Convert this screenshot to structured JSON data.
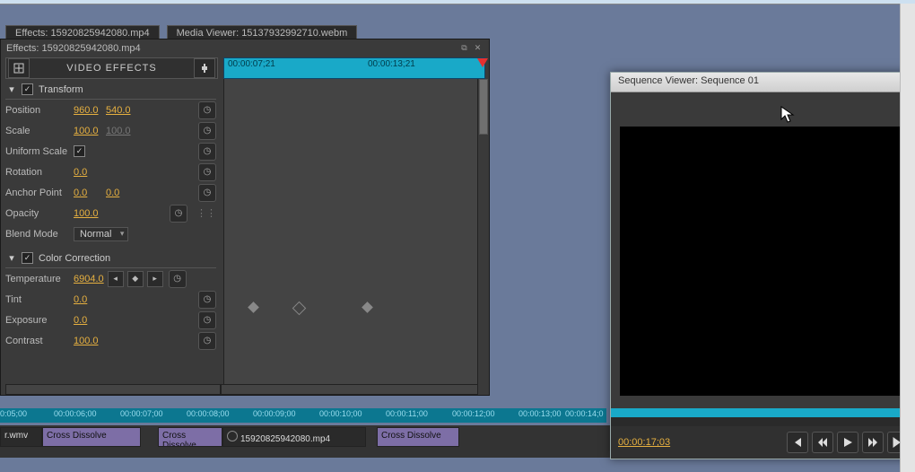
{
  "tabs": {
    "effects": "Effects: 15920825942080.mp4",
    "media": "Media Viewer: 15137932992710.webm"
  },
  "subtitle": "Effects: 15920825942080.mp4",
  "header": {
    "title": "VIDEO EFFECTS"
  },
  "ruler": {
    "t1": "00:00:07;21",
    "t2": "00:00:13;21"
  },
  "sections": {
    "transform": "Transform",
    "color": "Color Correction"
  },
  "params": {
    "position_lbl": "Position",
    "position_x": "960.0",
    "position_y": "540.0",
    "scale_lbl": "Scale",
    "scale_x": "100.0",
    "scale_y": "100.0",
    "uniform_lbl": "Uniform Scale",
    "rotation_lbl": "Rotation",
    "rotation_v": "0.0",
    "anchor_lbl": "Anchor Point",
    "anchor_x": "0.0",
    "anchor_y": "0.0",
    "opacity_lbl": "Opacity",
    "opacity_v": "100.0",
    "blend_lbl": "Blend Mode",
    "blend_v": "Normal",
    "temp_lbl": "Temperature",
    "temp_v": "6904.0",
    "tint_lbl": "Tint",
    "tint_v": "0.0",
    "exposure_lbl": "Exposure",
    "exposure_v": "0.0",
    "contrast_lbl": "Contrast",
    "contrast_v": "100.0"
  },
  "timeline": {
    "labels": [
      "0:05;00",
      "00:00:06;00",
      "00:00:07;00",
      "00:00:08;00",
      "00:00:09;00",
      "00:00:10;00",
      "00:00:11;00",
      "00:00:12;00",
      "00:00:13;00",
      "00:00:14;0"
    ]
  },
  "clips": {
    "c1": "r.wmv",
    "c2": "Cross Dissolve",
    "c3": "Cross Dissolve",
    "c4": "15920825942080.mp4",
    "c5": "Cross Dissolve"
  },
  "seq": {
    "title": "Sequence Viewer: Sequence 01",
    "tc": "00:00:17;03"
  }
}
